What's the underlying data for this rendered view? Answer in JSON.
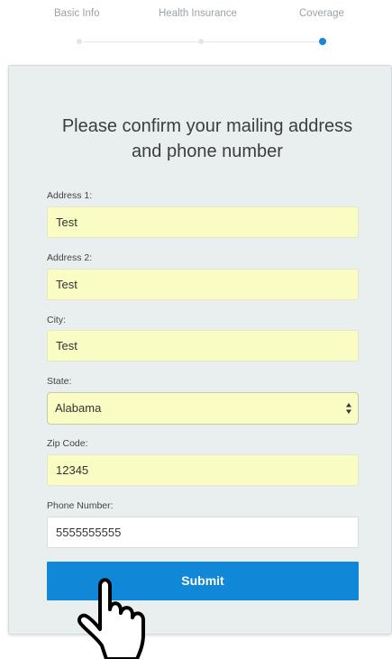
{
  "steps": [
    {
      "label": "Basic Info",
      "state": "complete"
    },
    {
      "label": "Health Insurance",
      "state": "complete"
    },
    {
      "label": "Coverage",
      "state": "active"
    }
  ],
  "form": {
    "title_line1": "Please confirm your mailing address",
    "title_line2": "and phone number",
    "address1": {
      "label": "Address 1:",
      "value": "Test"
    },
    "address2": {
      "label": "Address 2:",
      "value": "Test"
    },
    "city": {
      "label": "City:",
      "value": "Test"
    },
    "state": {
      "label": "State:",
      "value": "Alabama"
    },
    "zip": {
      "label": "Zip Code:",
      "value": "12345"
    },
    "phone": {
      "label": "Phone Number:",
      "value": "5555555555"
    },
    "submit_label": "Submit"
  },
  "colors": {
    "accent": "#1187d8",
    "autofill": "#fafdc3",
    "card": "#e9efef"
  },
  "icons": {
    "cursor": "hand-pointer-icon",
    "select_arrows": "updown-arrows-icon"
  }
}
